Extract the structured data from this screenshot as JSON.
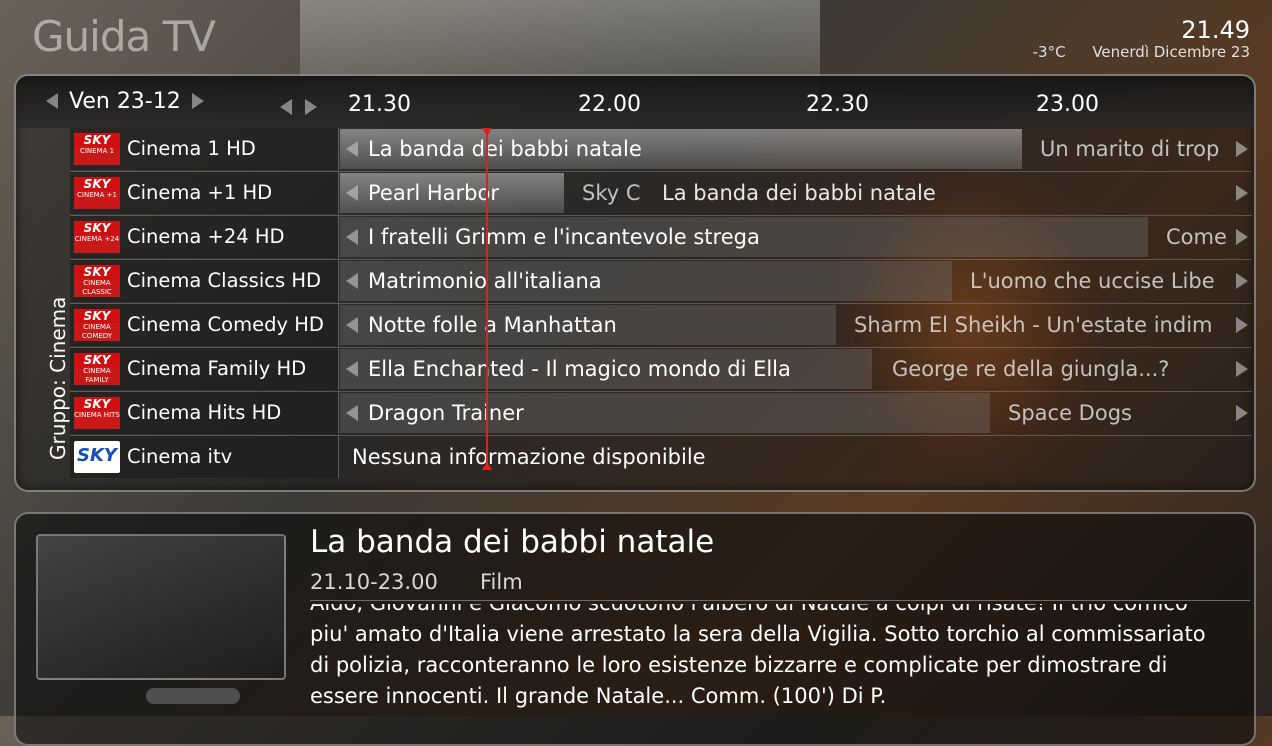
{
  "header": {
    "title": "Guida TV",
    "clock": "21.49",
    "temperature": "-3°C",
    "date": "Venerdì Dicembre 23"
  },
  "guide": {
    "day": "Ven 23-12",
    "times": [
      "21.30",
      "22.00",
      "22.30",
      "23.00"
    ],
    "group_label": "Gruppo: Cinema",
    "channels": [
      {
        "name": "Cinema 1 HD",
        "logo_top": "SKY",
        "logo_sub": "CINEMA 1",
        "programs": [
          {
            "title": "La banda dei babbi natale",
            "state": "current"
          },
          {
            "title": "Un marito di trop",
            "state": "next"
          }
        ]
      },
      {
        "name": "Cinema +1 HD",
        "logo_top": "SKY",
        "logo_sub": "CINEMA +1",
        "programs": [
          {
            "title": "Pearl Harbor",
            "state": "current"
          },
          {
            "title": "Sky C",
            "state": "next"
          },
          {
            "title": "La banda dei babbi natale",
            "state": "next"
          }
        ]
      },
      {
        "name": "Cinema +24 HD",
        "logo_top": "SKY",
        "logo_sub": "CINEMA +24",
        "programs": [
          {
            "title": "I fratelli Grimm e l'incantevole strega",
            "state": "current"
          },
          {
            "title": "Come",
            "state": "next"
          }
        ]
      },
      {
        "name": "Cinema Classics HD",
        "logo_top": "SKY",
        "logo_sub": "CINEMA CLASSIC",
        "programs": [
          {
            "title": "Matrimonio all'italiana",
            "state": "current"
          },
          {
            "title": "L'uomo che uccise Libe",
            "state": "next"
          }
        ]
      },
      {
        "name": "Cinema Comedy HD",
        "logo_top": "SKY",
        "logo_sub": "CINEMA COMEDY",
        "programs": [
          {
            "title": "Notte folle a Manhattan",
            "state": "current"
          },
          {
            "title": "Sharm El Sheikh - Un'estate indim",
            "state": "next"
          }
        ]
      },
      {
        "name": "Cinema Family HD",
        "logo_top": "SKY",
        "logo_sub": "CINEMA FAMILY",
        "programs": [
          {
            "title": "Ella Enchanted - Il magico mondo di Ella",
            "state": "current"
          },
          {
            "title": "George re della giungla...?",
            "state": "next"
          }
        ]
      },
      {
        "name": "Cinema Hits HD",
        "logo_top": "SKY",
        "logo_sub": "CINEMA HITS",
        "programs": [
          {
            "title": "Dragon Trainer",
            "state": "current"
          },
          {
            "title": "Space Dogs",
            "state": "next"
          }
        ]
      },
      {
        "name": "Cinema itv",
        "logo_top": "SKY",
        "logo_sub": "",
        "programs": [
          {
            "title": "Nessuna informazione disponibile",
            "state": "none"
          }
        ]
      }
    ]
  },
  "details": {
    "title": "La banda dei babbi natale",
    "time": "21.10-23.00",
    "genre": "Film",
    "description": "Aldo, Giovanni e Giacomo scuotono l'albero di Natale a colpi di risate! Il trio comico piu' amato d'Italia viene arrestato la sera della Vigilia. Sotto torchio al commissariato di polizia, racconteranno le loro esistenze bizzarre e complicate per dimostrare di essere innocenti. Il grande Natale... Comm. (100') Di P."
  },
  "colors": {
    "now_line": "#e02020",
    "sky_red": "#d01010",
    "sky_blue": "#1a4fb3"
  }
}
